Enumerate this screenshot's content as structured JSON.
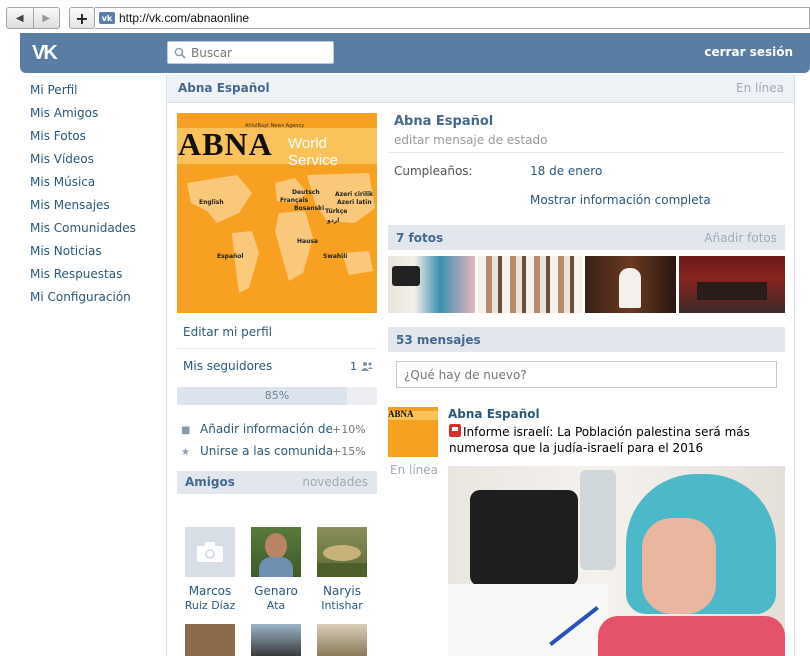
{
  "browser": {
    "url": "http://vk.com/abnaonline",
    "back": "◀",
    "forward": "▶",
    "new_tab": "+"
  },
  "header": {
    "logo": "VK",
    "search_placeholder": "Buscar",
    "logout": "cerrar sesión",
    "color": "#597da3"
  },
  "menu": [
    "Mi Perfil",
    "Mis Amigos",
    "Mis Fotos",
    "Mis Vídeos",
    "Mis Música",
    "Mis Mensajes",
    "Mis Comunidades",
    "Mis Noticias",
    "Mis Respuestas",
    "Mi Configuración"
  ],
  "profile": {
    "name": "Abna Español",
    "online": "En línea",
    "status_placeholder": "editar mensaje de estado",
    "birthday_label": "Cumpleaños:",
    "birthday_value": "18 de enero",
    "more_info": "Mostrar información completa",
    "avatar_logo": {
      "abna": "ABNA",
      "service": "World Service",
      "agency": "AhlulBayt News Agency",
      "langs": [
        "English",
        "Deutsch",
        "Français",
        "Bosanski",
        "Azeri cirilik",
        "Azeri latin",
        "Türkçe",
        "اردو",
        "Hausa",
        "Swahili",
        "Español"
      ]
    }
  },
  "left": {
    "edit_profile": "Editar mi perfil",
    "followers_label": "Mis seguidores",
    "followers_count": "1",
    "progress_text": "85%",
    "progress_value": 0.85,
    "tasks": [
      {
        "label": "Añadir información de la",
        "percent": "+10%",
        "icon": "lock-icon"
      },
      {
        "label": "Unirse a las comunidades",
        "percent": "+15%",
        "icon": "star-icon"
      }
    ]
  },
  "friends": {
    "title": "Amigos",
    "link": "novedades",
    "list": [
      {
        "first": "Marcos",
        "last": "Ruiz Díaz"
      },
      {
        "first": "Genaro",
        "last": "Ata"
      },
      {
        "first": "Naryis",
        "last": "Intishar"
      }
    ]
  },
  "photos": {
    "title": "7 fotos",
    "add": "Añadir fotos"
  },
  "wall": {
    "title": "53 mensajes",
    "placeholder": "¿Qué hay de nuevo?",
    "post": {
      "author": "Abna Español",
      "online": "En línea",
      "text": "Informe israelí: La Población palestina será más numerosa que la judía-israelí para el 2016"
    }
  }
}
